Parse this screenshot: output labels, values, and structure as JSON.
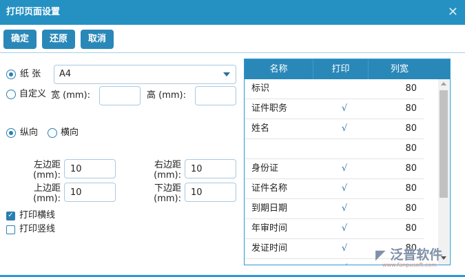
{
  "title": "打印页面设置",
  "toolbar": {
    "ok": "确定",
    "reset": "还原",
    "cancel": "取消"
  },
  "paper": {
    "label": "纸 张",
    "value": "A4",
    "custom_label": "自定义",
    "width_label": "宽 (mm):",
    "height_label": "高 (mm):",
    "width_value": "",
    "height_value": ""
  },
  "orientation": {
    "portrait": "纵向",
    "landscape": "横向"
  },
  "margins": {
    "left_label": "左边距(mm):",
    "left": "10",
    "right_label": "右边距(mm):",
    "right": "10",
    "top_label": "上边距(mm):",
    "top": "10",
    "bottom_label": "下边距(mm):",
    "bottom": "10"
  },
  "options": {
    "hlines": "打印横线",
    "vlines": "打印竖线"
  },
  "grid": {
    "headers": [
      "名称",
      "打印",
      "列宽"
    ],
    "rows": [
      {
        "name": "标识",
        "print": "",
        "width": "80"
      },
      {
        "name": "证件职务",
        "print": "√",
        "width": "80"
      },
      {
        "name": "姓名",
        "print": "√",
        "width": "80"
      },
      {
        "name": "",
        "print": "",
        "width": "80"
      },
      {
        "name": "身份证",
        "print": "√",
        "width": "80"
      },
      {
        "name": "证件名称",
        "print": "√",
        "width": "80"
      },
      {
        "name": "到期日期",
        "print": "√",
        "width": "80"
      },
      {
        "name": "年审时间",
        "print": "√",
        "width": "80"
      },
      {
        "name": "发证时间",
        "print": "√",
        "width": "80"
      },
      {
        "name": "",
        "print": "√",
        "width": ""
      }
    ]
  },
  "watermark": {
    "name": "泛普软件",
    "url": "www.fanpusoft.com"
  },
  "colors": {
    "accent": "#2591c2",
    "button": "#2a88b8"
  }
}
